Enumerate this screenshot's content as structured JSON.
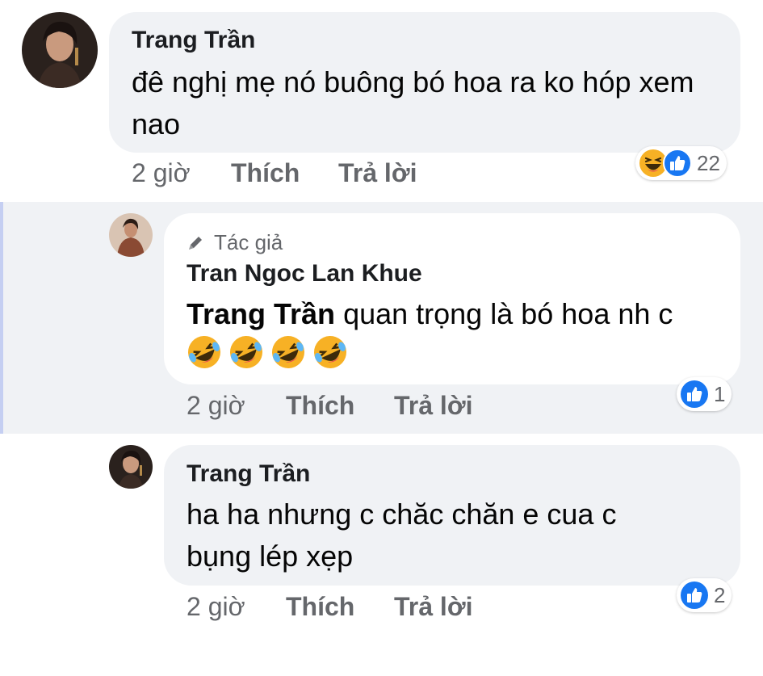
{
  "comments": [
    {
      "author": "Trang Trần",
      "text": "đê nghị mẹ nó buông bó hoa ra ko hóp xem nao",
      "time": "2 giờ",
      "like_label": "Thích",
      "reply_label": "Trả lời",
      "reaction_count": "22",
      "reaction_icons": [
        "haha-icon",
        "like-icon"
      ]
    },
    {
      "author_badge": "Tác giả",
      "author": "Tran Ngoc Lan Khue",
      "mention": "Trang Trần",
      "text": "quan trọng là bó hoa nh c",
      "emojis": [
        "rofl-icon",
        "rofl-icon",
        "rofl-icon",
        "rofl-icon"
      ],
      "time": "2 giờ",
      "like_label": "Thích",
      "reply_label": "Trả lời",
      "reaction_count": "1",
      "reaction_icons": [
        "like-icon"
      ]
    },
    {
      "author": "Trang Trần",
      "text": "ha ha nhưng c chăc chăn e cua c bụng lép xẹp",
      "time": "2 giờ",
      "like_label": "Thích",
      "reply_label": "Trả lời",
      "reaction_count": "2",
      "reaction_icons": [
        "like-icon"
      ]
    }
  ],
  "colors": {
    "bubble": "#f0f2f5",
    "highlight": "#f0f2f5",
    "highlight_border": "#c5cff2",
    "meta_text": "#65676b",
    "like_blue": "#1877f2",
    "haha_yellow": "#f7b125"
  }
}
